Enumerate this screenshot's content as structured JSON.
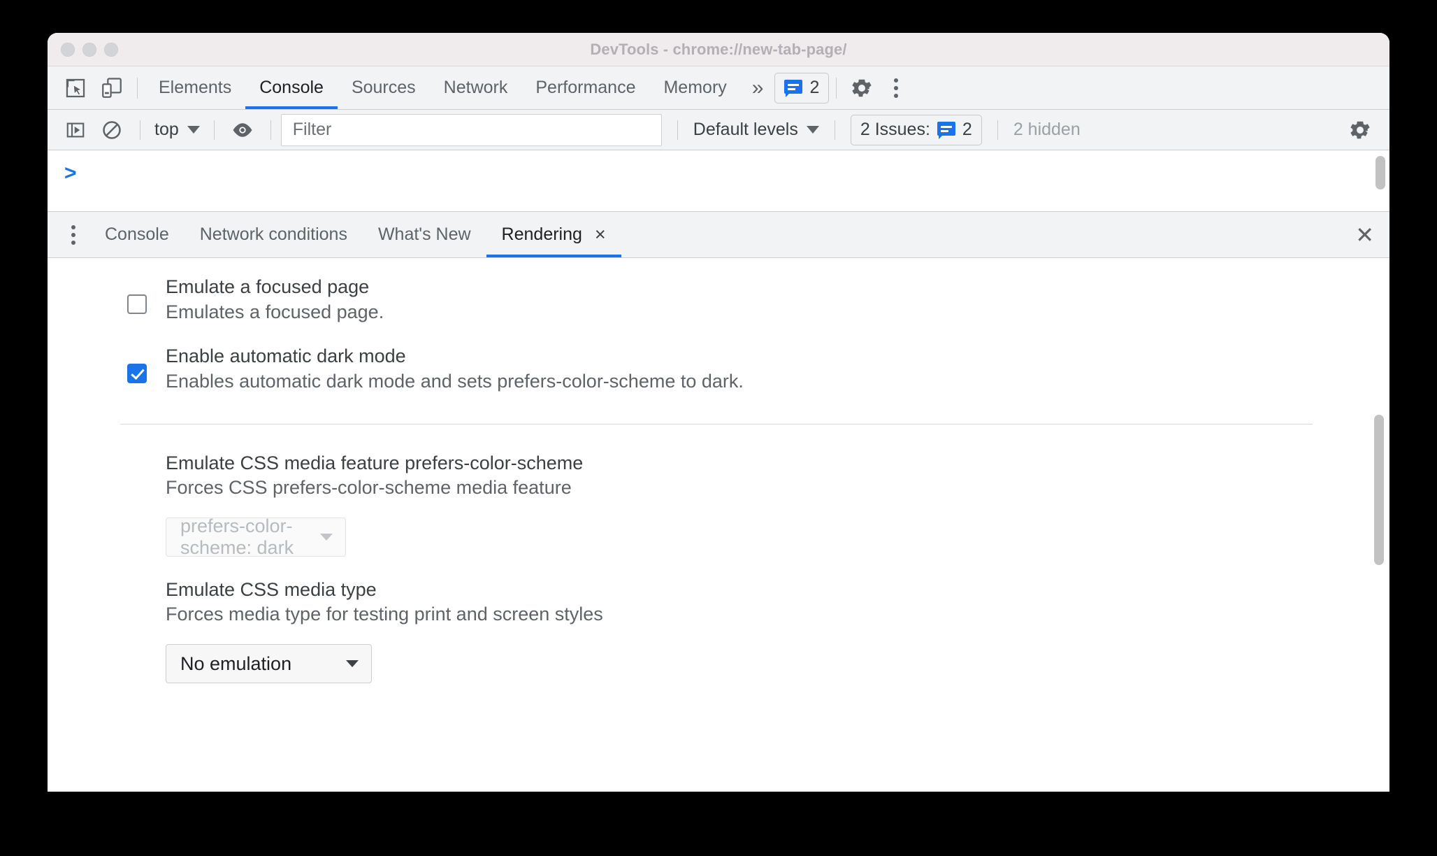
{
  "window": {
    "title": "DevTools - chrome://new-tab-page/",
    "traffic_lights": [
      "close",
      "minimize",
      "zoom"
    ]
  },
  "main_toolbar": {
    "inspect_icon": "inspect-cursor-icon",
    "device_icon": "device-toolbar-icon",
    "tabs": [
      {
        "label": "Elements",
        "active": false
      },
      {
        "label": "Console",
        "active": true
      },
      {
        "label": "Sources",
        "active": false
      },
      {
        "label": "Network",
        "active": false
      },
      {
        "label": "Performance",
        "active": false
      },
      {
        "label": "Memory",
        "active": false
      }
    ],
    "more_tabs_icon": "»",
    "issues_badge": {
      "icon": "issue-bubble-icon",
      "count": "2"
    },
    "settings_icon": "gear-icon",
    "more_options_icon": "vertical-dots-icon"
  },
  "console_toolbar": {
    "sidebar_toggle_icon": "console-sidebar-icon",
    "clear_icon": "clear-console-icon",
    "context": {
      "label": "top",
      "caret": "▼"
    },
    "eye_icon": "live-expression-eye-icon",
    "filter": {
      "value": "",
      "placeholder": "Filter"
    },
    "levels": {
      "label": "Default levels",
      "caret": "▼"
    },
    "issues_button": {
      "label": "2 Issues:",
      "icon": "issue-bubble-icon",
      "count": "2"
    },
    "hidden_label": "2 hidden",
    "settings_icon": "gear-icon"
  },
  "console": {
    "prompt": ">"
  },
  "drawer": {
    "menu_icon": "vertical-dots-icon",
    "tabs": [
      {
        "label": "Console",
        "active": false,
        "closable": false
      },
      {
        "label": "Network conditions",
        "active": false,
        "closable": false
      },
      {
        "label": "What's New",
        "active": false,
        "closable": false
      },
      {
        "label": "Rendering",
        "active": true,
        "closable": true,
        "close_glyph": "×"
      }
    ],
    "close_glyph": "✕"
  },
  "rendering": {
    "options": [
      {
        "title": "Emulate a focused page",
        "desc": "Emulates a focused page.",
        "checked": false
      },
      {
        "title": "Enable automatic dark mode",
        "desc": "Enables automatic dark mode and sets prefers-color-scheme to dark.",
        "checked": true
      }
    ],
    "sections": [
      {
        "title": "Emulate CSS media feature prefers-color-scheme",
        "desc": "Forces CSS prefers-color-scheme media feature",
        "select_value": "prefers-color-scheme: dark",
        "disabled": true
      },
      {
        "title": "Emulate CSS media type",
        "desc": "Forces media type for testing print and screen styles",
        "select_value": "No emulation",
        "disabled": false
      }
    ]
  },
  "colors": {
    "accent": "#1a73e8",
    "toolbar_bg": "#f1f3f4",
    "titlebar_bg": "#f0ecee",
    "text_primary": "#3c4043",
    "text_secondary": "#5f6368",
    "text_muted": "#9aa0a6"
  }
}
